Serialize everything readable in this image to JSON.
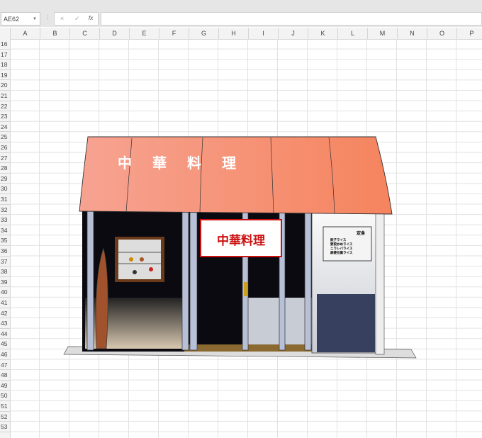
{
  "formula_bar": {
    "name_box": "AE62",
    "cancel_icon": "×",
    "enter_icon": "✓",
    "function_icon": "fx",
    "value": ""
  },
  "columns": [
    "A",
    "B",
    "C",
    "D",
    "E",
    "F",
    "G",
    "H",
    "I",
    "J",
    "K",
    "L",
    "M",
    "N",
    "O",
    "P"
  ],
  "rows": [
    "16",
    "17",
    "18",
    "19",
    "20",
    "21",
    "22",
    "23",
    "24",
    "25",
    "26",
    "27",
    "28",
    "29",
    "30",
    "31",
    "32",
    "33",
    "34",
    "35",
    "36",
    "37",
    "38",
    "39",
    "40",
    "41",
    "42",
    "43",
    "44",
    "45",
    "46",
    "47",
    "48",
    "49",
    "50",
    "51",
    "52",
    "53"
  ],
  "drawing": {
    "awning_text": [
      "中",
      "華",
      "料",
      "理"
    ],
    "noren_text": "中華料理",
    "menu_board": {
      "title": "定食",
      "items": [
        "餃子ライス",
        "野菜炒めライス",
        "ニラレバライス",
        "麻婆豆腐ライス"
      ]
    },
    "colors": {
      "awning": "#f58a6c",
      "awning_light": "#f7a090",
      "shutter": "#384060",
      "noren_red": "#cc1111"
    }
  }
}
